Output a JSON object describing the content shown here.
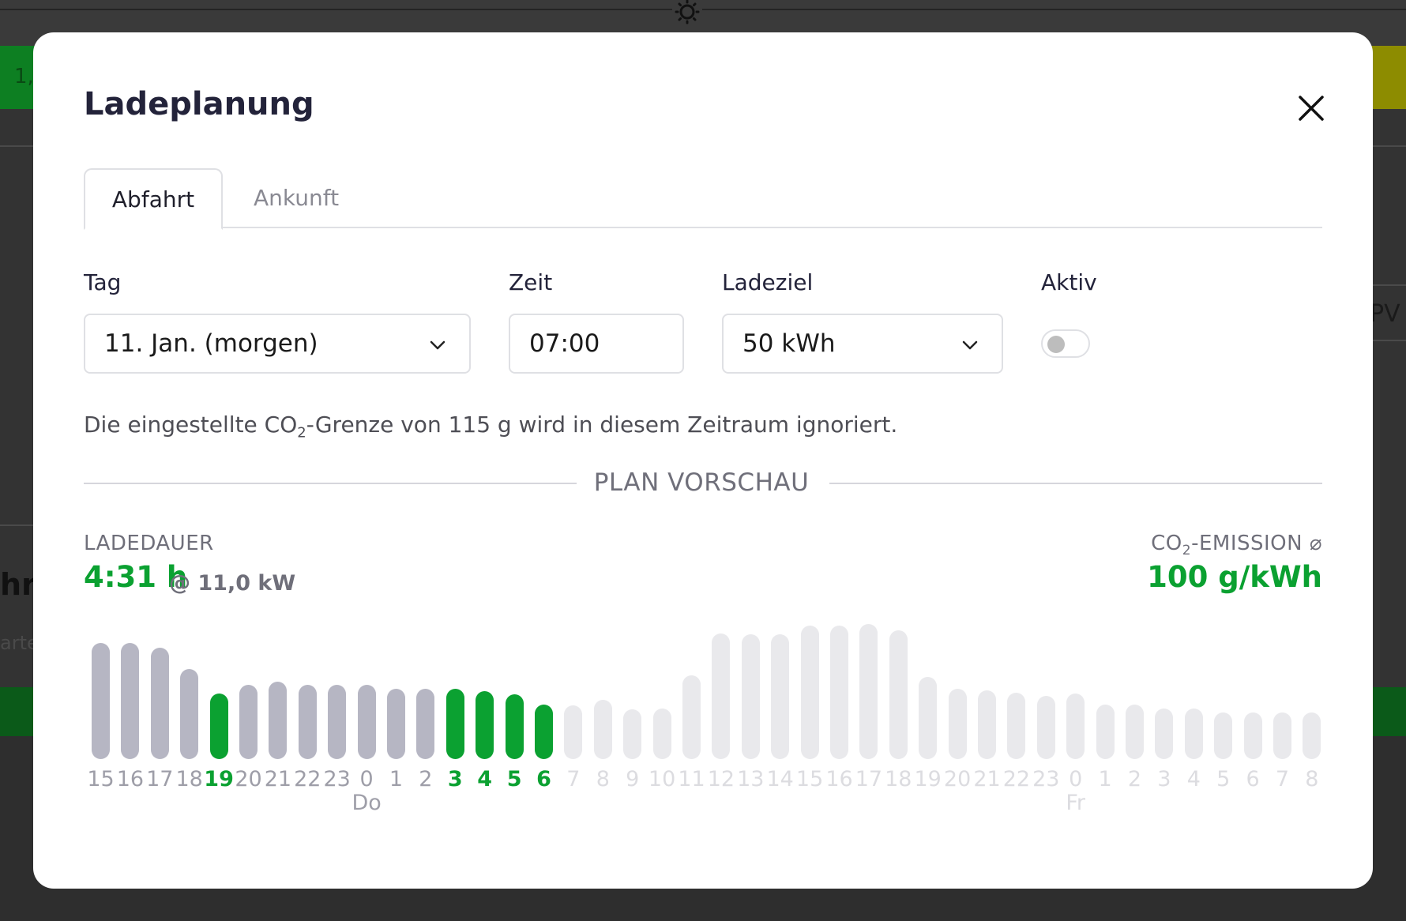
{
  "modal": {
    "title": "Ladeplanung",
    "close_icon": "close-icon"
  },
  "tabs": [
    {
      "label": "Abfahrt",
      "active": true
    },
    {
      "label": "Ankunft",
      "active": false
    }
  ],
  "form": {
    "day": {
      "label": "Tag",
      "value": "11. Jan. (morgen)"
    },
    "time": {
      "label": "Zeit",
      "value": "07:00"
    },
    "target": {
      "label": "Ladeziel",
      "value": "50 kWh"
    },
    "active": {
      "label": "Aktiv",
      "checked": false
    }
  },
  "note": {
    "prefix": "Die eingestellte CO",
    "subscript": "2",
    "suffix": "-Grenze von 115 g wird in diesem Zeitraum ignoriert."
  },
  "preview": {
    "title": "PLAN VORSCHAU",
    "duration_label": "LADEDAUER",
    "duration_value": "4:31 h",
    "power": "@ 11,0 kW",
    "co2_label_prefix": "CO",
    "co2_label_sub": "2",
    "co2_label_suffix": "-EMISSION ⌀",
    "co2_value": "100 g/kWh"
  },
  "colors": {
    "charging": "#0ba131",
    "past": "#b6b6c3",
    "future": "#e9e9ec",
    "future_text": "#dcdce0",
    "past_text": "#9e9ea8"
  },
  "chart_data": {
    "type": "bar",
    "categories": [
      "15",
      "16",
      "17",
      "18",
      "19",
      "20",
      "21",
      "22",
      "23",
      "0",
      "1",
      "2",
      "3",
      "4",
      "5",
      "6",
      "7",
      "8",
      "9",
      "10",
      "11",
      "12",
      "13",
      "14",
      "15",
      "16",
      "17",
      "18",
      "19",
      "20",
      "21",
      "22",
      "23",
      "0",
      "1",
      "2",
      "3",
      "4",
      "5",
      "6",
      "7",
      "8"
    ],
    "values": [
      147,
      147,
      141,
      114,
      83,
      94,
      98,
      94,
      94,
      94,
      89,
      89,
      89,
      86,
      82,
      69,
      68,
      75,
      63,
      64,
      106,
      159,
      158,
      158,
      169,
      169,
      171,
      163,
      104,
      89,
      87,
      84,
      80,
      83,
      69,
      69,
      64,
      64,
      59,
      59,
      59,
      59
    ],
    "state": [
      "past",
      "past",
      "past",
      "past",
      "charging",
      "past",
      "past",
      "past",
      "past",
      "past",
      "past",
      "past",
      "charging",
      "charging",
      "charging",
      "charging",
      "future",
      "future",
      "future",
      "future",
      "future",
      "future",
      "future",
      "future",
      "future",
      "future",
      "future",
      "future",
      "future",
      "future",
      "future",
      "future",
      "future",
      "future",
      "future",
      "future",
      "future",
      "future",
      "future",
      "future",
      "future",
      "future"
    ],
    "day_labels": [
      {
        "label": "Do",
        "index": 9
      },
      {
        "label": "Fr",
        "index": 33
      }
    ],
    "ylabel": "",
    "xlabel": ""
  }
}
